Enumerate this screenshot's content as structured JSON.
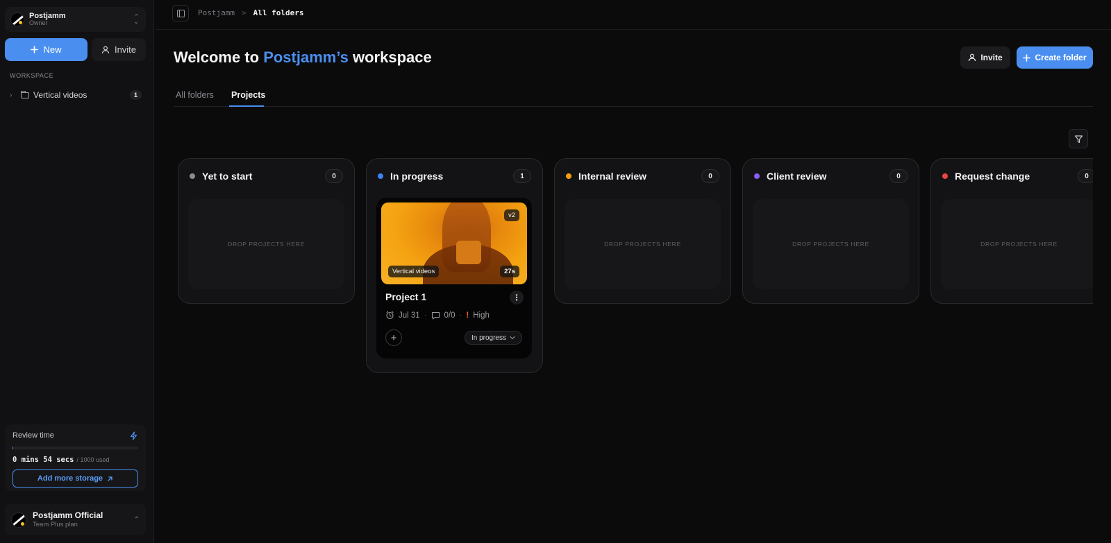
{
  "workspace": {
    "name": "Postjamm",
    "role": "Owner"
  },
  "sidebar": {
    "new_label": "New",
    "invite_label": "Invite",
    "section_label": "WORKSPACE",
    "items": [
      {
        "label": "Vertical videos",
        "count": "1"
      }
    ],
    "review": {
      "title": "Review time",
      "used": "0 mins 54 secs",
      "total": "/ 1000 used",
      "progress_fraction": 0.001,
      "storage_button": "Add more storage"
    },
    "account": {
      "name": "Postjamm Official",
      "plan": "Team Plus plan"
    }
  },
  "breadcrumb": {
    "root": "Postjamm",
    "separator": ">",
    "current": "All folders"
  },
  "header": {
    "title_prefix": "Welcome to ",
    "title_highlight": "Postjamm’s",
    "title_suffix": " workspace",
    "invite_label": "Invite",
    "create_label": "Create folder"
  },
  "tabs": [
    {
      "label": "All folders"
    },
    {
      "label": "Projects"
    }
  ],
  "active_tab": "Projects",
  "colors": {
    "accent": "#4a8ff0",
    "yet_to_start": "#8b8b92",
    "in_progress": "#3b82f6",
    "internal_review": "#f59e0b",
    "client_review": "#8b5cf6",
    "request_change": "#ef4444"
  },
  "columns": [
    {
      "title": "Yet to start",
      "count": "0",
      "drop_label": "DROP PROJECTS HERE"
    },
    {
      "title": "In progress",
      "count": "1",
      "drop_label": ""
    },
    {
      "title": "Internal review",
      "count": "0",
      "drop_label": "DROP PROJECTS HERE"
    },
    {
      "title": "Client review",
      "count": "0",
      "drop_label": "DROP PROJECTS HERE"
    },
    {
      "title": "Request change",
      "count": "0",
      "drop_label": "DROP PROJECTS HERE"
    }
  ],
  "project": {
    "title": "Project 1",
    "version": "v2",
    "folder": "Vertical videos",
    "duration": "27s",
    "due": "Jul 31",
    "comments": "0/0",
    "priority": "High",
    "status": "In progress"
  }
}
